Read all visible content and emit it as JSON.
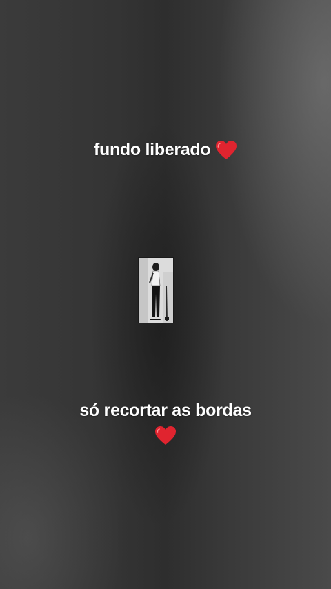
{
  "captions": {
    "top": "fundo liberado",
    "bottom": "só recortar as bordas"
  },
  "icons": {
    "heart": "red-heart-emoji"
  },
  "colors": {
    "text": "#ffffff",
    "heart": "#e0242f",
    "background": "#363636"
  }
}
